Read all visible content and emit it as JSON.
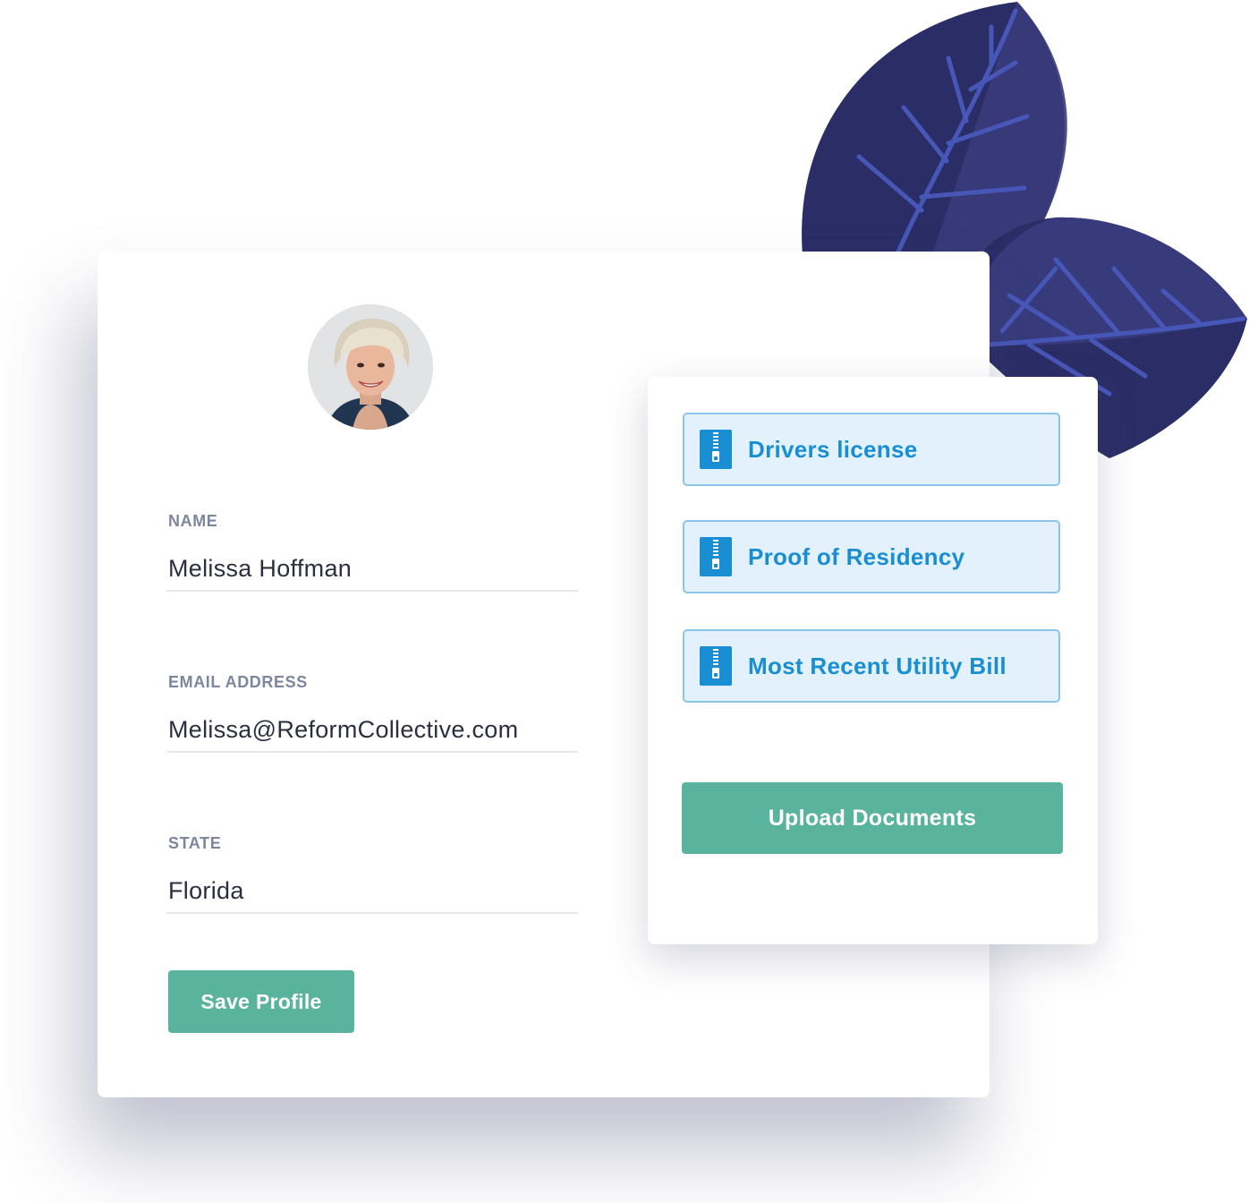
{
  "profile": {
    "avatar_alt": "Profile photo",
    "fields": {
      "name": {
        "label": "NAME",
        "value": "Melissa  Hoffman"
      },
      "email": {
        "label": "EMAIL ADDRESS",
        "value": "Melissa@ReformCollective.com"
      },
      "state": {
        "label": "STATE",
        "value": "Florida"
      }
    },
    "save_label": "Save Profile"
  },
  "documents": {
    "items": [
      {
        "label": "Drivers license",
        "icon": "zip-file-icon"
      },
      {
        "label": "Proof of Residency",
        "icon": "zip-file-icon"
      },
      {
        "label": "Most Recent Utility Bill",
        "icon": "zip-file-icon"
      }
    ],
    "upload_label": "Upload Documents"
  },
  "colors": {
    "accent_green": "#5ab39d",
    "doc_blue": "#1a8ed3",
    "doc_bg": "#e3f1fd",
    "leaf_dark": "#272a62",
    "leaf_mid": "#373a7a",
    "leaf_vein": "#4655b5"
  }
}
